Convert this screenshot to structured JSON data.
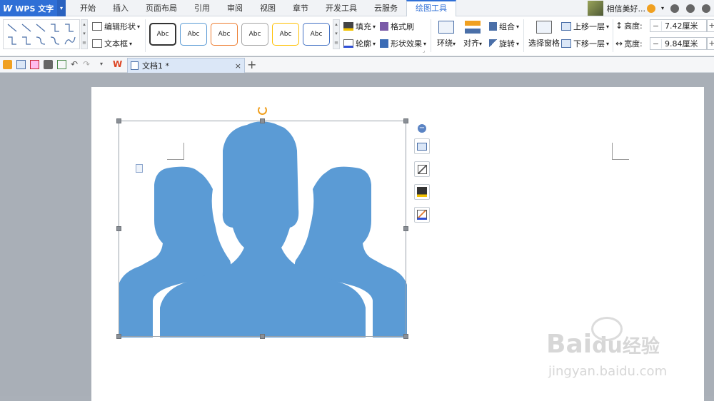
{
  "app": {
    "name": "WPS 文字"
  },
  "tabs": [
    "开始",
    "插入",
    "页面布局",
    "引用",
    "审阅",
    "视图",
    "章节",
    "开发工具",
    "云服务",
    "绘图工具"
  ],
  "active_tab": "绘图工具",
  "user": {
    "name": "相信美好..."
  },
  "ribbon": {
    "edit_shape": "编辑形状",
    "text_box": "文本框",
    "style_label": "Abc",
    "fill": "填充",
    "format_brush": "格式刷",
    "outline": "轮廓",
    "shape_effect": "形状效果",
    "wrap": "环绕",
    "align": "对齐",
    "group": "组合",
    "rotate": "旋转",
    "selection_pane": "选择窗格",
    "bring_forward": "上移一层",
    "send_backward": "下移一层",
    "height_label": "高度:",
    "height_value": "7.42厘米",
    "width_label": "宽度:",
    "width_value": "9.84厘米",
    "minus": "−",
    "plus": "+"
  },
  "doc_tab": {
    "title": "文档1 *",
    "close": "×",
    "new": "+"
  },
  "colors": {
    "accent": "#2f6fd6",
    "shape_fill": "#5b9bd5"
  },
  "watermark": {
    "brand": "Bai",
    "brand_cn": "经验",
    "url": "jingyan.baidu.com"
  }
}
